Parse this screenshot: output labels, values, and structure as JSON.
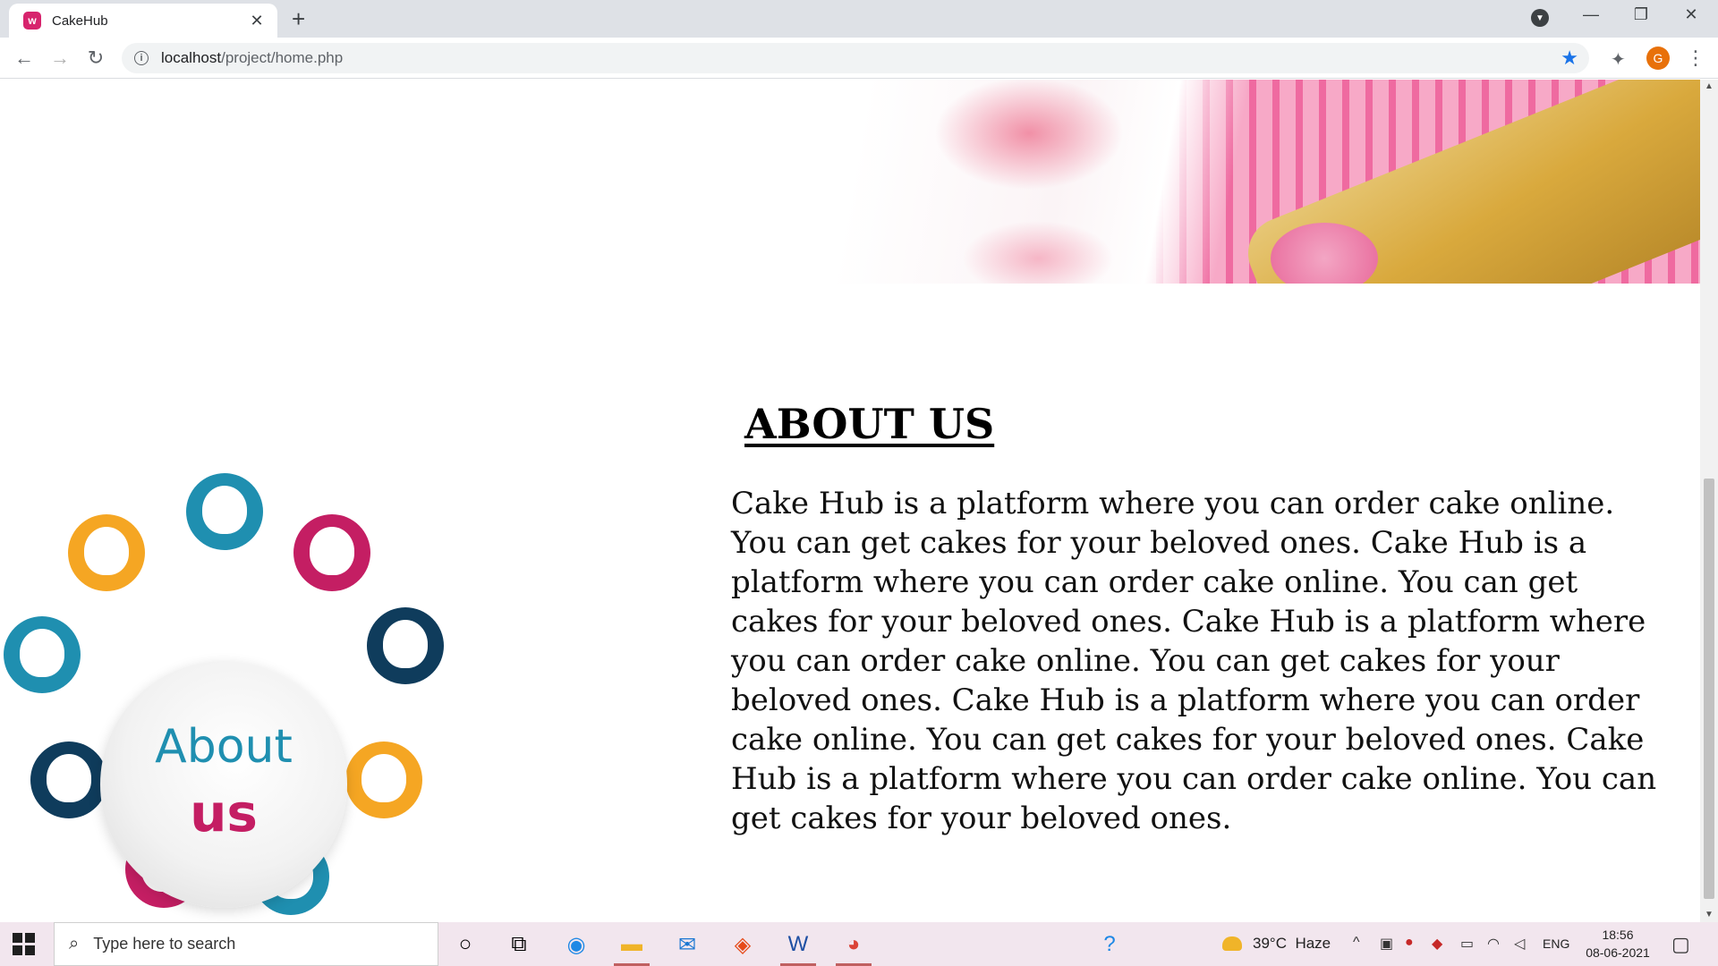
{
  "browser": {
    "tab_title": "CakeHub",
    "favicon_letter": "w",
    "url_host": "localhost",
    "url_path": "/project/home.php",
    "profile_initial": "G"
  },
  "page": {
    "graphic": {
      "word1": "About",
      "word2": "us"
    },
    "heading": "ABOUT US",
    "body": "Cake Hub is a platform where you can order cake online. You can get cakes for your beloved ones. Cake Hub is a platform where you can order cake online. You can get cakes for your beloved ones. Cake Hub is a platform where you can order cake online. You can get cakes for your beloved ones. Cake Hub is a platform where you can order cake online. You can get cakes for your beloved ones. Cake Hub is a platform where you can order cake online. You can get cakes for your beloved ones."
  },
  "taskbar": {
    "search_placeholder": "Type here to search",
    "weather_temp": "39°C",
    "weather_desc": "Haze",
    "lang": "ENG",
    "time": "18:56",
    "date": "08-06-2021"
  },
  "colors": {
    "accent_blue": "#1a73e8",
    "about_blue": "#1f8fb0",
    "about_pink": "#c41e63",
    "taskbar_bg": "#f2e6ee"
  }
}
